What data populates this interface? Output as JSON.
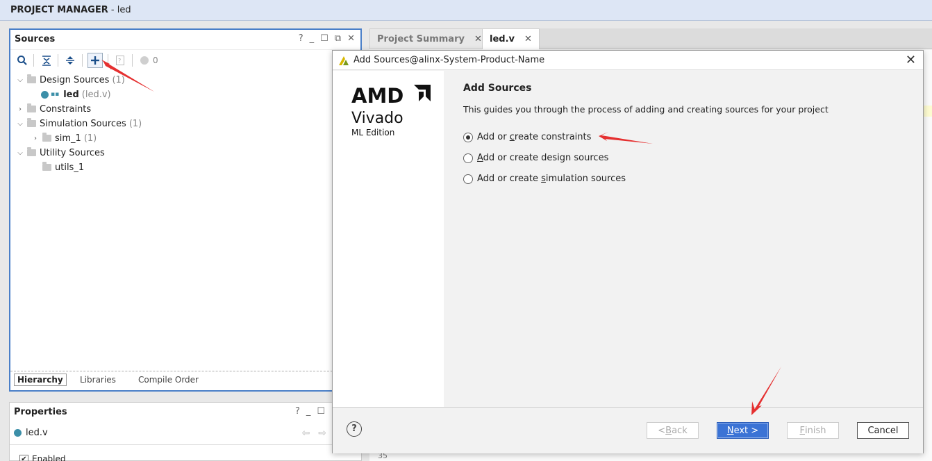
{
  "header": {
    "title_bold": "PROJECT MANAGER",
    "title_rest": " - led"
  },
  "sources": {
    "title": "Sources",
    "controls": [
      "?",
      "_",
      "☐",
      "⧉",
      "✕"
    ],
    "count": "0",
    "tree": {
      "design": {
        "label": "Design Sources",
        "count": "(1)"
      },
      "led": {
        "label": "led",
        "file": "(led.v)"
      },
      "constraints": {
        "label": "Constraints"
      },
      "simulation": {
        "label": "Simulation Sources",
        "count": "(1)"
      },
      "sim1": {
        "label": "sim_1",
        "count": "(1)"
      },
      "utility": {
        "label": "Utility Sources"
      },
      "utils1": {
        "label": "utils_1"
      }
    },
    "tabs": [
      "Hierarchy",
      "Libraries",
      "Compile Order"
    ]
  },
  "properties": {
    "title": "Properties",
    "controls": [
      "?",
      "_",
      "☐"
    ],
    "file": "led.v",
    "enabled": "Enabled"
  },
  "editor": {
    "tabs": [
      "Project Summary",
      "led.v"
    ],
    "line": "35"
  },
  "dialog": {
    "title": "Add Sources@alinx-System-Product-Name",
    "brand": {
      "amd": "AMD",
      "product": "Vivado",
      "edition": "ML Edition"
    },
    "heading": "Add Sources",
    "description": "This guides you through the process of adding and creating sources for your project",
    "options": [
      {
        "pre": "Add or ",
        "ul": "c",
        "post": "reate constraints",
        "checked": true
      },
      {
        "pre": "",
        "ul": "A",
        "post": "dd or create design sources",
        "checked": false
      },
      {
        "pre": "Add or create ",
        "ul": "s",
        "post": "imulation sources",
        "checked": false
      }
    ],
    "buttons": {
      "back": {
        "pre": "< ",
        "ul": "B",
        "post": "ack"
      },
      "next": {
        "pre": "",
        "ul": "N",
        "post": "ext >"
      },
      "finish": {
        "pre": "",
        "ul": "F",
        "post": "inish"
      },
      "cancel": "Cancel"
    }
  }
}
